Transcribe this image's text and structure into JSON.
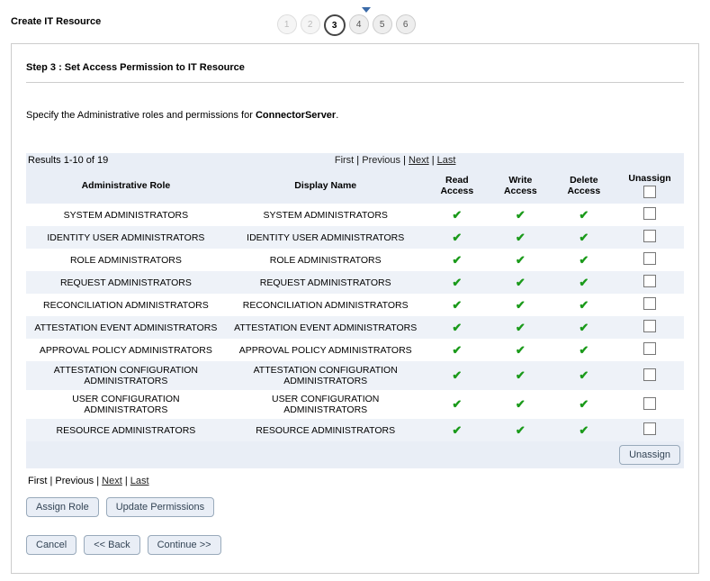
{
  "header": {
    "title": "Create IT Resource",
    "current_step": 3,
    "steps": [
      {
        "n": 1,
        "state": "disabled"
      },
      {
        "n": 2,
        "state": "disabled"
      },
      {
        "n": 3,
        "state": "current"
      },
      {
        "n": 4,
        "state": "normal"
      },
      {
        "n": 5,
        "state": "normal"
      },
      {
        "n": 6,
        "state": "normal"
      }
    ]
  },
  "step": {
    "heading": "Step 3 : Set Access Permission to IT Resource",
    "instruction_prefix": "Specify the Administrative roles and permissions for ",
    "resource_name": "ConnectorServer",
    "instruction_suffix": "."
  },
  "pager": {
    "results_label": "Results 1-10 of 19",
    "first": "First",
    "previous": "Previous",
    "next": "Next",
    "last": "Last"
  },
  "columns": {
    "role": "Administrative Role",
    "display": "Display Name",
    "read": "Read Access",
    "write": "Write Access",
    "delete": "Delete Access",
    "unassign": "Unassign"
  },
  "rows": [
    {
      "role": "SYSTEM ADMINISTRATORS",
      "display": "SYSTEM ADMINISTRATORS",
      "read": true,
      "write": true,
      "delete": true
    },
    {
      "role": "IDENTITY USER ADMINISTRATORS",
      "display": "IDENTITY USER ADMINISTRATORS",
      "read": true,
      "write": true,
      "delete": true
    },
    {
      "role": "ROLE ADMINISTRATORS",
      "display": "ROLE ADMINISTRATORS",
      "read": true,
      "write": true,
      "delete": true
    },
    {
      "role": "REQUEST ADMINISTRATORS",
      "display": "REQUEST ADMINISTRATORS",
      "read": true,
      "write": true,
      "delete": true
    },
    {
      "role": "RECONCILIATION ADMINISTRATORS",
      "display": "RECONCILIATION ADMINISTRATORS",
      "read": true,
      "write": true,
      "delete": true
    },
    {
      "role": "ATTESTATION EVENT ADMINISTRATORS",
      "display": "ATTESTATION EVENT ADMINISTRATORS",
      "read": true,
      "write": true,
      "delete": true
    },
    {
      "role": "APPROVAL POLICY ADMINISTRATORS",
      "display": "APPROVAL POLICY ADMINISTRATORS",
      "read": true,
      "write": true,
      "delete": true
    },
    {
      "role": "ATTESTATION CONFIGURATION ADMINISTRATORS",
      "display": "ATTESTATION CONFIGURATION ADMINISTRATORS",
      "read": true,
      "write": true,
      "delete": true
    },
    {
      "role": "USER CONFIGURATION ADMINISTRATORS",
      "display": "USER CONFIGURATION ADMINISTRATORS",
      "read": true,
      "write": true,
      "delete": true
    },
    {
      "role": "RESOURCE ADMINISTRATORS",
      "display": "RESOURCE ADMINISTRATORS",
      "read": true,
      "write": true,
      "delete": true
    }
  ],
  "buttons": {
    "unassign": "Unassign",
    "assign_role": "Assign Role",
    "update_permissions": "Update Permissions",
    "cancel": "Cancel",
    "back": "<< Back",
    "continue": "Continue >>"
  }
}
